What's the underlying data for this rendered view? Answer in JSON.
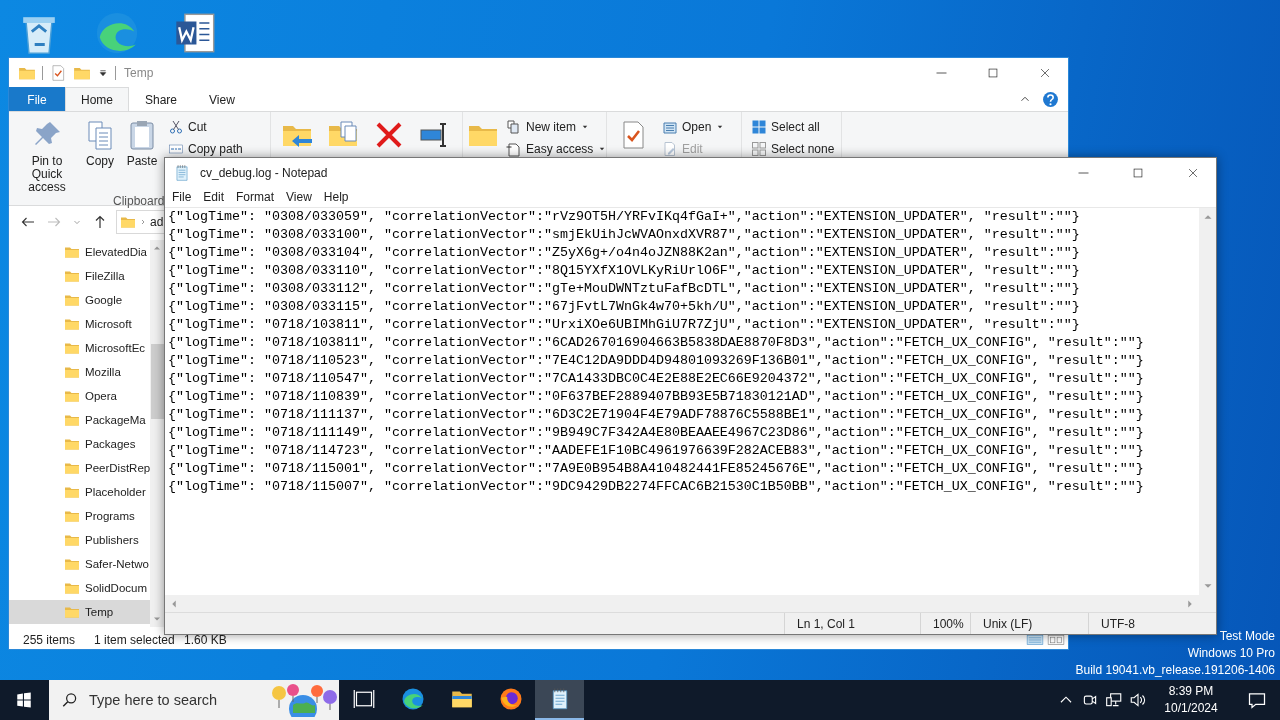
{
  "desktop": {
    "icons": [
      {
        "kind": "recycle"
      },
      {
        "kind": "edge"
      },
      {
        "kind": "word"
      }
    ],
    "system_text": [
      "Test Mode",
      "Windows 10 Pro",
      "Build 19041.vb_release.191206-1406"
    ]
  },
  "explorer": {
    "quick_access": [
      {
        "kind": "folder"
      },
      {
        "kind": "properties"
      },
      {
        "kind": "folder"
      },
      {
        "kind": "customize"
      }
    ],
    "title": "Temp",
    "ribbon_tabs": [
      {
        "label": "File",
        "kind": "menu",
        "selected": false
      },
      {
        "label": "Home",
        "kind": "tab",
        "selected": true
      },
      {
        "label": "Share",
        "kind": "tab",
        "selected": false
      },
      {
        "label": "View",
        "kind": "tab",
        "selected": false
      }
    ],
    "ribbon_groups": [
      {
        "label": "Clipboard",
        "large": [
          {
            "label": "Pin to Quick access",
            "kind": "pin"
          },
          {
            "label": "Copy",
            "kind": "copy"
          },
          {
            "label": "Paste",
            "kind": "paste"
          }
        ],
        "small": [
          {
            "label": "Cut",
            "kind": "cut",
            "dropdown": false,
            "disabled": false
          },
          {
            "label": "Copy path",
            "kind": "copypath",
            "dropdown": false,
            "disabled": false
          }
        ]
      },
      {
        "large": [
          {
            "kind": "moveto"
          },
          {
            "kind": "copyto"
          },
          {
            "kind": "delete"
          },
          {
            "kind": "rename"
          }
        ]
      },
      {
        "large": [
          {
            "kind": "newfolder"
          }
        ],
        "small": [
          {
            "label": "New item",
            "kind": "newitem",
            "dropdown": true,
            "disabled": false
          },
          {
            "label": "Easy access",
            "kind": "easyaccess",
            "dropdown": true,
            "disabled": false
          }
        ]
      },
      {
        "large": [
          {
            "kind": "properties"
          }
        ],
        "small": [
          {
            "label": "Open",
            "kind": "open",
            "dropdown": true,
            "disabled": false
          },
          {
            "label": "Edit",
            "kind": "edit",
            "dropdown": false,
            "disabled": true
          }
        ]
      },
      {
        "small": [
          {
            "label": "Select all",
            "kind": "selectall",
            "dropdown": false,
            "disabled": false
          },
          {
            "label": "Select none",
            "kind": "selectnone",
            "dropdown": false,
            "disabled": false
          }
        ]
      }
    ],
    "address": "ad",
    "tree": [
      {
        "label": "ElevatedDia",
        "selected": false
      },
      {
        "label": "FileZilla",
        "selected": false
      },
      {
        "label": "Google",
        "selected": false
      },
      {
        "label": "Microsoft",
        "selected": false
      },
      {
        "label": "MicrosoftEc",
        "selected": false
      },
      {
        "label": "Mozilla",
        "selected": false
      },
      {
        "label": "Opera",
        "selected": false
      },
      {
        "label": "PackageMa",
        "selected": false
      },
      {
        "label": "Packages",
        "selected": false
      },
      {
        "label": "PeerDistRep",
        "selected": false
      },
      {
        "label": "Placeholder",
        "selected": false
      },
      {
        "label": "Programs",
        "selected": false
      },
      {
        "label": "Publishers",
        "selected": false
      },
      {
        "label": "Safer-Netwo",
        "selected": false
      },
      {
        "label": "SolidDocum",
        "selected": false
      },
      {
        "label": "Temp",
        "selected": true
      }
    ],
    "status": [
      "255 items",
      "1 item selected",
      "1.60 KB"
    ]
  },
  "notepad": {
    "title": "cv_debug.log - Notepad",
    "menu": [
      "File",
      "Edit",
      "Format",
      "View",
      "Help"
    ],
    "lines": [
      "{\"logTime\": \"0308/033059\", \"correlationVector\":\"rVz9OT5H/YRFvIKq4fGaI+\",\"action\":\"EXTENSION_UPDATER\", \"result\":\"\"}",
      "{\"logTime\": \"0308/033100\", \"correlationVector\":\"smjEkUihJcWVAOnxdXVR87\",\"action\":\"EXTENSION_UPDATER\", \"result\":\"\"}",
      "{\"logTime\": \"0308/033104\", \"correlationVector\":\"Z5yX6g+/o4n4oJZN88K2an\",\"action\":\"EXTENSION_UPDATER\", \"result\":\"\"}",
      "{\"logTime\": \"0308/033110\", \"correlationVector\":\"8Q15YXfX1OVLKyRiUrlO6F\",\"action\":\"EXTENSION_UPDATER\", \"result\":\"\"}",
      "{\"logTime\": \"0308/033112\", \"correlationVector\":\"gTe+MouDWNTztuFafBcDTL\",\"action\":\"EXTENSION_UPDATER\", \"result\":\"\"}",
      "{\"logTime\": \"0308/033115\", \"correlationVector\":\"67jFvtL7WnGk4w70+5kh/U\",\"action\":\"EXTENSION_UPDATER\", \"result\":\"\"}",
      "{\"logTime\": \"0718/103811\", \"correlationVector\":\"UrxiXOe6UBIMhGiU7R7ZjU\",\"action\":\"EXTENSION_UPDATER\", \"result\":\"\"}",
      "{\"logTime\": \"0718/103811\", \"correlationVector\":\"6CAD267016904663B5838DAE8870F8D3\",\"action\":\"FETCH_UX_CONFIG\", \"result\":\"\"}",
      "{\"logTime\": \"0718/110523\", \"correlationVector\":\"7E4C12DA9DDD4D94801093269F136B01\",\"action\":\"FETCH_UX_CONFIG\", \"result\":\"\"}",
      "{\"logTime\": \"0718/110547\", \"correlationVector\":\"7CA1433DBC0C4E2E88E2EC66E9204372\",\"action\":\"FETCH_UX_CONFIG\", \"result\":\"\"}",
      "{\"logTime\": \"0718/110839\", \"correlationVector\":\"0F637BEF2889407BB93E5B71830121AD\",\"action\":\"FETCH_UX_CONFIG\", \"result\":\"\"}",
      "{\"logTime\": \"0718/111137\", \"correlationVector\":\"6D3C2E71904F4E79ADF78876C5588BE1\",\"action\":\"FETCH_UX_CONFIG\", \"result\":\"\"}",
      "{\"logTime\": \"0718/111149\", \"correlationVector\":\"9B949C7F342A4E80BEAAEE4967C23D86\",\"action\":\"FETCH_UX_CONFIG\", \"result\":\"\"}",
      "{\"logTime\": \"0718/114723\", \"correlationVector\":\"AADEFE1F10BC4961976639F282ACEB83\",\"action\":\"FETCH_UX_CONFIG\", \"result\":\"\"}",
      "{\"logTime\": \"0718/115001\", \"correlationVector\":\"7A9E0B954B8A410482441FE85245676E\",\"action\":\"FETCH_UX_CONFIG\", \"result\":\"\"}",
      "{\"logTime\": \"0718/115007\", \"correlationVector\":\"9DC9429DB2274FFCAC6B21530C1B50BB\",\"action\":\"FETCH_UX_CONFIG\", \"result\":\"\"}"
    ],
    "status": [
      "Ln 1, Col 1",
      "100%",
      "Unix (LF)",
      "UTF-8"
    ]
  },
  "taskbar": {
    "search": {
      "placeholder": "Type here to search"
    },
    "apps": [
      {
        "kind": "taskview",
        "selected": false
      },
      {
        "kind": "edge",
        "selected": false
      },
      {
        "kind": "explorer",
        "selected": false
      },
      {
        "kind": "firefox",
        "selected": false
      },
      {
        "kind": "notepad",
        "selected": true
      }
    ],
    "tray": [
      {
        "kind": "chevron"
      },
      {
        "kind": "meet"
      },
      {
        "kind": "network"
      },
      {
        "kind": "volume"
      }
    ],
    "time": "8:39 PM",
    "date": "10/1/2024"
  }
}
